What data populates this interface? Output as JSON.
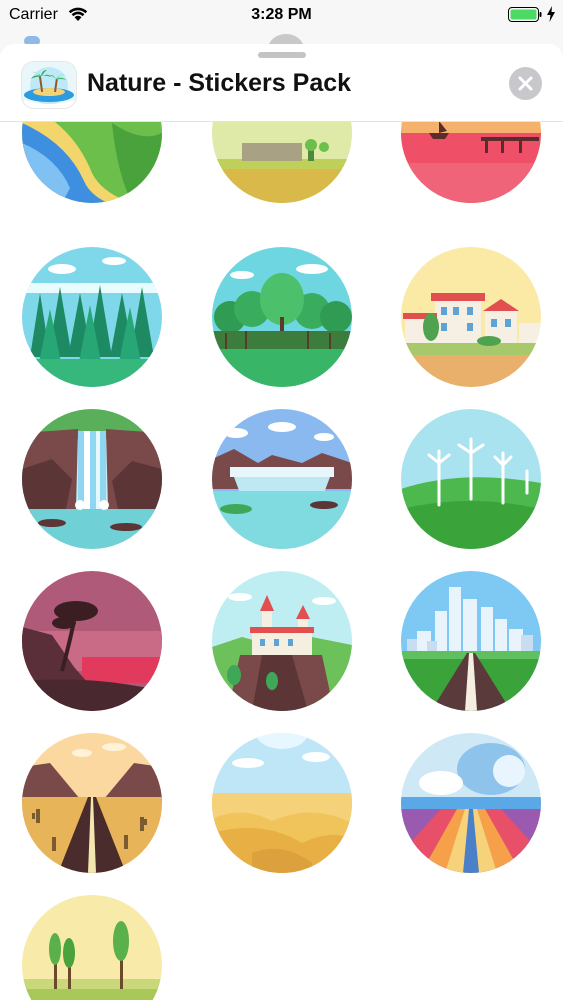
{
  "status_bar": {
    "carrier": "Carrier",
    "time": "3:28 PM"
  },
  "sheet": {
    "title": "Nature - Stickers Pack",
    "app_icon": "beach-island-icon",
    "close_icon": "close-icon"
  },
  "stickers": [
    {
      "name": "river-valley-sticker"
    },
    {
      "name": "town-fields-sticker"
    },
    {
      "name": "sunset-pier-sticker"
    },
    {
      "name": "pine-forest-sticker"
    },
    {
      "name": "deciduous-forest-sticker"
    },
    {
      "name": "village-houses-sticker"
    },
    {
      "name": "waterfall-sticker"
    },
    {
      "name": "dam-lake-sticker"
    },
    {
      "name": "wind-turbines-sticker"
    },
    {
      "name": "lone-tree-sunset-sticker"
    },
    {
      "name": "castle-cliff-sticker"
    },
    {
      "name": "city-road-sticker"
    },
    {
      "name": "desert-canyon-road-sticker"
    },
    {
      "name": "sand-dunes-sticker"
    },
    {
      "name": "colorful-road-sticker"
    },
    {
      "name": "poplar-meadow-sticker"
    }
  ],
  "colors": {
    "sheet_background": "#ffffff",
    "screen_background": "#f7f7f7",
    "close_button": "#c7c7cc",
    "battery": "#4cd964"
  }
}
